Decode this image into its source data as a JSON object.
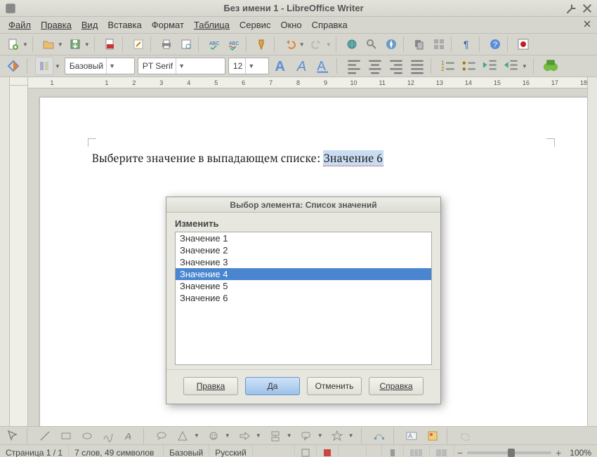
{
  "window": {
    "title": "Без имени 1 - LibreOffice Writer"
  },
  "menu": {
    "file": "Файл",
    "edit": "Правка",
    "view": "Вид",
    "insert": "Вставка",
    "format": "Формат",
    "table": "Таблица",
    "tools": "Сервис",
    "window": "Окно",
    "help": "Справка"
  },
  "format_bar": {
    "style": "Базовый",
    "font_name": "PT Serif",
    "font_size": "12"
  },
  "ruler": {
    "numbers": [
      "1",
      "",
      "1",
      "2",
      "3",
      "4",
      "5",
      "6",
      "7",
      "8",
      "9",
      "10",
      "11",
      "12",
      "13",
      "14",
      "15",
      "16",
      "17",
      "18"
    ]
  },
  "document": {
    "prompt_text": "Выберите значение в выпадающем списке: ",
    "field_value": "Значение 6"
  },
  "dialog": {
    "title": "Выбор элемента: Список значений",
    "group_label": "Изменить",
    "items": [
      "Значение 1",
      "Значение 2",
      "Значение 3",
      "Значение 4",
      "Значение 5",
      "Значение 6"
    ],
    "selected_index": 3,
    "buttons": {
      "edit": "Правка",
      "ok": "Да",
      "cancel": "Отменить",
      "help": "Справка"
    }
  },
  "status": {
    "page": "Страница 1 / 1",
    "words": "7 слов, 49 символов",
    "style": "Базовый",
    "language": "Русский",
    "zoom": "100%"
  }
}
